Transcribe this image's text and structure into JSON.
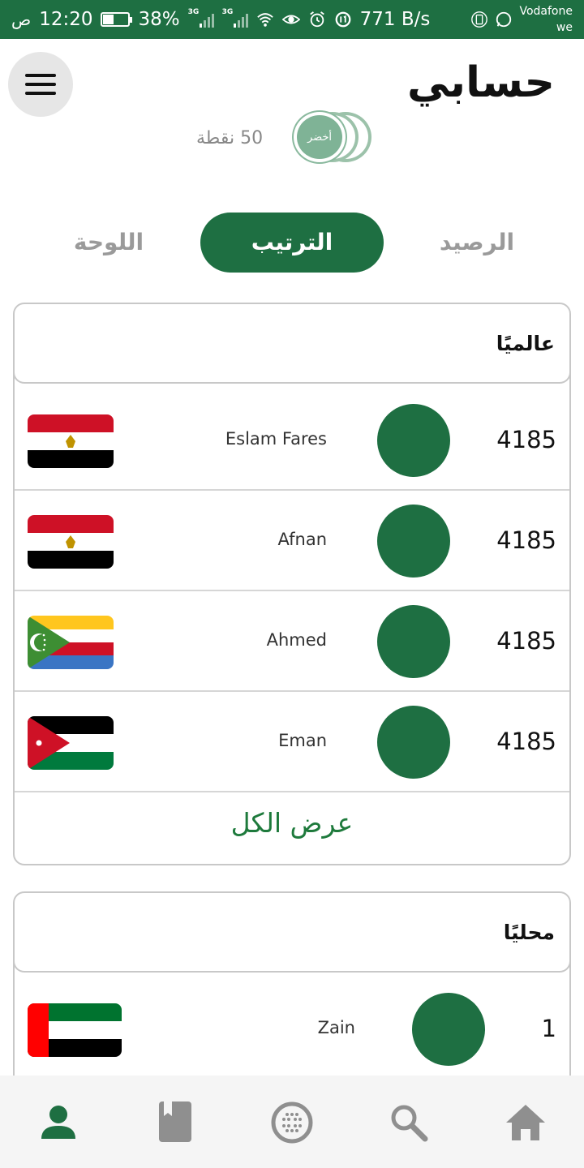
{
  "status_bar": {
    "time": "12:20",
    "ampm": "ص",
    "battery_percent": "38%",
    "battery_level": 0.38,
    "network_1": "3G",
    "network_2": "3G",
    "net_speed": "771 B/s",
    "carrier_line1": "Vodafone",
    "carrier_line2": "we"
  },
  "header": {
    "title": "حسابي",
    "menu_icon": "hamburger-menu-icon"
  },
  "points": {
    "text": "50 نقطة",
    "badge_label": "أخضر"
  },
  "tabs": [
    {
      "label": "الرصيد",
      "active": false
    },
    {
      "label": "الترتيب",
      "active": true
    },
    {
      "label": "اللوحة",
      "active": false
    }
  ],
  "global_ranking": {
    "title": "عالميًا",
    "rows": [
      {
        "score": "4185",
        "name": "Eslam Fares",
        "flag": "egypt"
      },
      {
        "score": "4185",
        "name": "Afnan",
        "flag": "egypt"
      },
      {
        "score": "4185",
        "name": "Ahmed",
        "flag": "comoros"
      },
      {
        "score": "4185",
        "name": "Eman",
        "flag": "jordan"
      }
    ],
    "view_all": "عرض الكل"
  },
  "local_ranking": {
    "title": "محليًا",
    "rows": [
      {
        "score": "1",
        "name": "Zain",
        "flag": "uae"
      }
    ]
  },
  "bottom_nav": [
    {
      "icon": "person-icon",
      "active": true
    },
    {
      "icon": "book-icon",
      "active": false
    },
    {
      "icon": "globe-dots-icon",
      "active": false
    },
    {
      "icon": "search-icon",
      "active": false
    },
    {
      "icon": "home-icon",
      "active": false
    }
  ],
  "colors": {
    "primary": "#1e6f42",
    "link": "#1e7a3c",
    "inactive": "#9a9a9a"
  }
}
